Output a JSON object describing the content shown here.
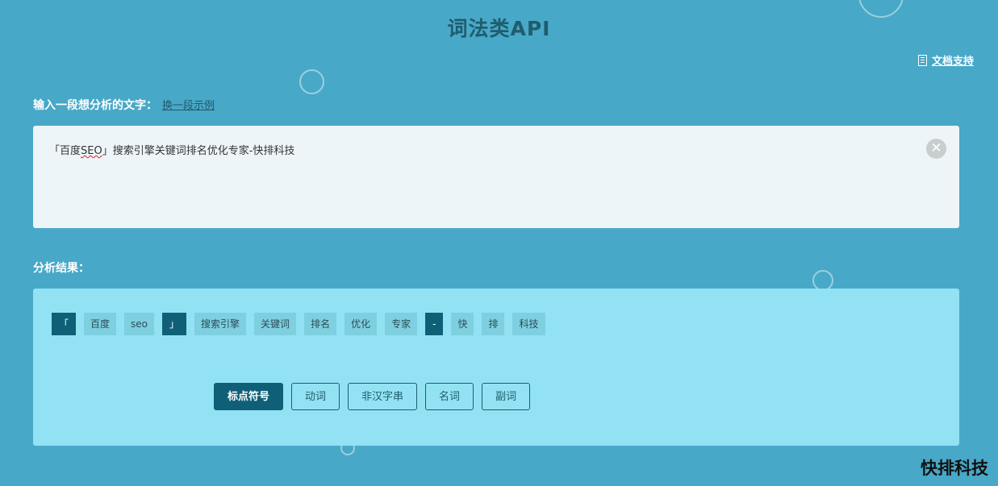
{
  "header": {
    "title": "词法类API",
    "doc_link": "文档支持"
  },
  "input": {
    "label": "输入一段想分析的文字：",
    "switch_example": "换一段示例",
    "text_before": "「百度",
    "text_spell": "SEO",
    "text_after": "」搜索引擎关键词排名优化专家-快排科技"
  },
  "result": {
    "label": "分析结果：",
    "tokens": [
      {
        "text": "「",
        "type": "punct"
      },
      {
        "text": "百度",
        "type": "word"
      },
      {
        "text": "seo",
        "type": "word"
      },
      {
        "text": "」",
        "type": "punct"
      },
      {
        "text": "搜索引擎",
        "type": "word"
      },
      {
        "text": "关键词",
        "type": "word"
      },
      {
        "text": "排名",
        "type": "word"
      },
      {
        "text": "优化",
        "type": "word"
      },
      {
        "text": "专家",
        "type": "word"
      },
      {
        "text": "-",
        "type": "punct"
      },
      {
        "text": "快",
        "type": "word"
      },
      {
        "text": "排",
        "type": "word"
      },
      {
        "text": "科技",
        "type": "word"
      }
    ],
    "legend": [
      {
        "label": "标点符号",
        "active": true
      },
      {
        "label": "动词",
        "active": false
      },
      {
        "label": "非汉字串",
        "active": false
      },
      {
        "label": "名词",
        "active": false
      },
      {
        "label": "副词",
        "active": false
      }
    ]
  },
  "watermark": "快排科技",
  "colors": {
    "background": "#48a8c8",
    "title": "#1f5d6d",
    "input_bg": "#eef5f8",
    "result_bg": "#92e2f4",
    "token_bg": "#7ecfe0",
    "punct_bg": "#0f6077"
  }
}
